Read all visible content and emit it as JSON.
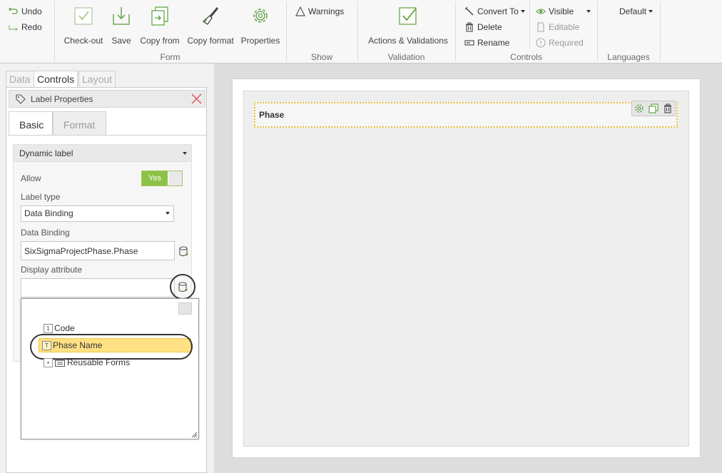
{
  "ribbon": {
    "undo_label": "Undo",
    "redo_label": "Redo",
    "form_group": {
      "label": "Form",
      "checkout_label": "Check-out",
      "save_label": "Save",
      "copy_from_label": "Copy from",
      "copy_format_label": "Copy format",
      "properties_label": "Properties"
    },
    "show_group": {
      "label": "Show",
      "warnings_label": "Warnings"
    },
    "validation_group": {
      "label": "Validation",
      "actions_label": "Actions & Validations"
    },
    "controls_group": {
      "label": "Controls",
      "convert_to_label": "Convert To",
      "delete_label": "Delete",
      "rename_label": "Rename",
      "visible_label": "Visible",
      "editable_label": "Editable",
      "required_label": "Required"
    },
    "languages_group": {
      "label": "Languages",
      "default_label": "Default"
    },
    "colors": {
      "accent_green": "#8cc246",
      "icon_green": "#5a9e3a"
    }
  },
  "left_panel": {
    "tabs": [
      "Data",
      "Controls",
      "Layout"
    ],
    "active_tab": "Controls",
    "properties": {
      "title": "Label Properties",
      "tabs": [
        "Basic",
        "Format"
      ],
      "active_tab": "Basic",
      "section_title": "Dynamic label",
      "allow_label": "Allow",
      "allow_value": "Yes",
      "label_type_label": "Label type",
      "label_type_value": "Data Binding",
      "data_binding_label": "Data Binding",
      "data_binding_value": "SixSigmaProjectPhase.Phase",
      "display_attribute_label": "Display attribute",
      "display_attribute_value": ""
    },
    "attribute_picker": {
      "items": [
        {
          "label": "Code",
          "icon": "attribute-icon"
        },
        {
          "label": "Phase Name",
          "icon": "text-attribute-icon",
          "selected": true
        },
        {
          "label": "Reusable Forms",
          "icon": "forms-icon",
          "expand": "+"
        }
      ]
    }
  },
  "canvas": {
    "field_label": "Phase",
    "highlight_color": "#e8c23c",
    "selected_item_color": "#ffe083"
  }
}
